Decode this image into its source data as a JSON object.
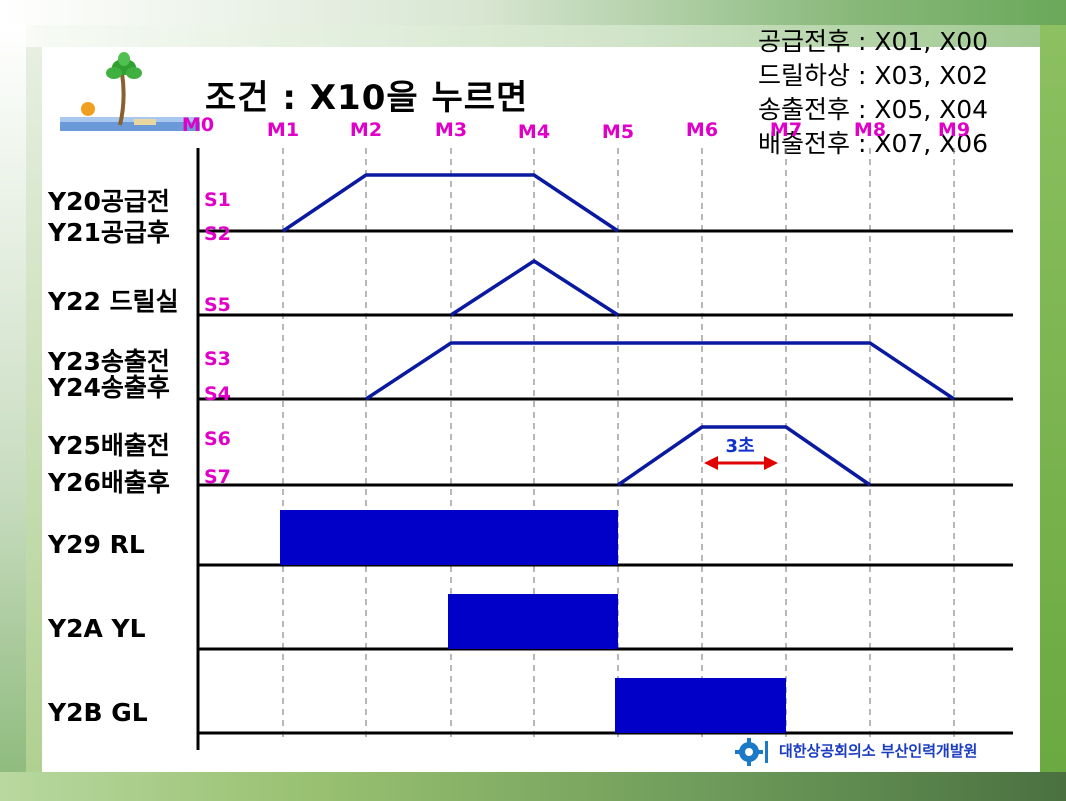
{
  "title": "조건 : X10을 누르면",
  "legend": [
    "공급전후 : X01, X00",
    "드릴하상 : X03, X02",
    "송출전후 : X05, X04",
    "배출전후 : X07, X06"
  ],
  "footer": "대한상공회의소 부산인력개발원",
  "timing_data": {
    "steps": [
      "M0",
      "M1",
      "M2",
      "M3",
      "M4",
      "M5",
      "M6",
      "M7",
      "M8",
      "M9"
    ],
    "rows": [
      {
        "label": "Y20공급전\nY21공급후",
        "label_lines": [
          "Y20공급전",
          "Y21공급후"
        ],
        "sensors": [
          "S1",
          "S2"
        ],
        "type": "trapezoid",
        "rise": [
          1,
          2
        ],
        "fall": [
          4,
          5
        ]
      },
      {
        "label": "Y22 드릴실",
        "label_lines": [
          "Y22 드릴실"
        ],
        "sensors": [
          "S5"
        ],
        "type": "triangle",
        "rise": [
          3,
          4
        ],
        "fall": [
          4,
          5
        ]
      },
      {
        "label": "Y23송출전\nY24송출후",
        "label_lines": [
          "Y23송출전",
          "Y24송출후"
        ],
        "sensors": [
          "S3",
          "S4"
        ],
        "type": "trapezoid",
        "rise": [
          2,
          3
        ],
        "fall": [
          8,
          9
        ]
      },
      {
        "label": "Y25배출전\nY26배출후",
        "label_lines": [
          "Y25배출전",
          "Y26배출후"
        ],
        "sensors": [
          "S6",
          "S7"
        ],
        "type": "trapezoid",
        "rise": [
          5,
          6
        ],
        "fall": [
          7,
          8
        ],
        "annotation": "3초"
      },
      {
        "label": "Y29 RL",
        "label_lines": [
          "Y29    RL"
        ],
        "sensors": [],
        "type": "pulse",
        "on": [
          1,
          5
        ]
      },
      {
        "label": "Y2A YL",
        "label_lines": [
          "Y2A    YL"
        ],
        "sensors": [],
        "type": "pulse",
        "on": [
          3,
          5
        ]
      },
      {
        "label": "Y2B GL",
        "label_lines": [
          "Y2B    GL"
        ],
        "sensors": [],
        "type": "pulse",
        "on": [
          5,
          7
        ]
      }
    ],
    "colors": {
      "signal": "#0a1aa0",
      "pulse": "#0000c8",
      "step_label": "#e000c8",
      "sensor_label": "#e000c8",
      "arrow": "#e00000",
      "annotation": "#1030d0"
    }
  }
}
